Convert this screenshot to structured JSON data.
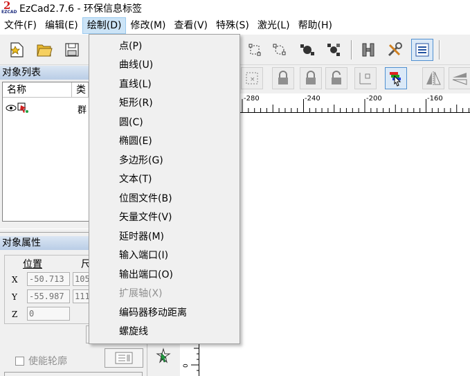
{
  "window": {
    "title": "EzCad2.7.6 - 环保信息标签",
    "logo_num": "2",
    "logo_label": "EZCAD"
  },
  "menubar": [
    "文件(F)",
    "编辑(E)",
    "绘制(D)",
    "修改(M)",
    "查看(V)",
    "特殊(S)",
    "激光(L)",
    "帮助(H)"
  ],
  "draw_menu": [
    {
      "label": "点(P)",
      "enabled": true
    },
    {
      "label": "曲线(U)",
      "enabled": true
    },
    {
      "label": "直线(L)",
      "enabled": true
    },
    {
      "label": "矩形(R)",
      "enabled": true
    },
    {
      "label": "圆(C)",
      "enabled": true
    },
    {
      "label": "椭圆(E)",
      "enabled": true
    },
    {
      "label": "多边形(G)",
      "enabled": true
    },
    {
      "label": "文本(T)",
      "enabled": true
    },
    {
      "label": "位图文件(B)",
      "enabled": true
    },
    {
      "label": "矢量文件(V)",
      "enabled": true
    },
    {
      "label": "延时器(M)",
      "enabled": true
    },
    {
      "label": "输入端口(I)",
      "enabled": true
    },
    {
      "label": "输出端口(O)",
      "enabled": true
    },
    {
      "label": "扩展轴(X)",
      "enabled": false
    },
    {
      "label": "编码器移动距离",
      "enabled": true
    },
    {
      "label": "螺旋线",
      "enabled": true
    }
  ],
  "object_list": {
    "title": "对象列表",
    "col_name": "名称",
    "col_type": "类",
    "row_type": "群"
  },
  "object_props": {
    "title": "对象属性",
    "pos_label": "位置",
    "size_label": "尺",
    "x_label": "X",
    "y_label": "Y",
    "z_label": "Z",
    "x_pos": "-50.713",
    "y_pos": "-55.987",
    "z_pos": "0",
    "x_size": "105.",
    "y_size": "111.",
    "enable_contour": "使能轮廓"
  },
  "ruler": {
    "ticks": [
      "-280",
      "-240",
      "-200",
      "-160"
    ]
  },
  "colors": {
    "menu_active": "#cce4f7",
    "panel_title": "#b9cde6"
  }
}
